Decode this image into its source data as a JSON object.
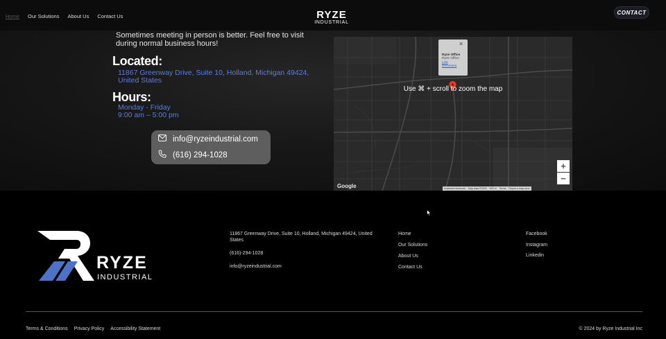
{
  "nav": {
    "home": "Home",
    "solutions": "Our Solutions",
    "about": "About Us",
    "contact": "Contact Us"
  },
  "brand": {
    "word": "RYZE",
    "sub": "INDUSTRIAL"
  },
  "cta": {
    "contact": "CONTACT"
  },
  "contact_section": {
    "intro": "Sometimes meeting in person is better. Feel free to visit during normal business hours!",
    "located_label": "Located:",
    "address": "11867 Greenway Drive, Suite 10, Holland, Michigan 49424, United States",
    "hours_label": "Hours:",
    "days": "Monday - Friday",
    "time": "9:00 am – 5:00 pm",
    "email": "info@ryzeindustrial.com",
    "phone": "(616) 294-1028"
  },
  "map": {
    "hint": "Use ⌘ + scroll to zoom the map",
    "info_title": "Ryze Office",
    "info_sub": "Ryze Office",
    "info_link": "Link",
    "info_directions": "Directions",
    "close": "✕",
    "zoom_in": "+",
    "zoom_out": "−",
    "google": "Google",
    "footer": [
      "Keyboard shortcuts",
      "Map data ©2024",
      "500 m",
      "Terms",
      "Report a map error"
    ]
  },
  "footer": {
    "address": "11867 Greenway Drive, Suite 10, Holland, Michigan 49424, United States",
    "phone": "(616)-294-1028",
    "email": "info@ryzeindustrial.com",
    "links": [
      "Home",
      "Our Solutions",
      "About Us",
      "Contact Us"
    ],
    "social": [
      "Facebook",
      "Instagram",
      "Linkedin"
    ],
    "legal": [
      "Terms & Conditions",
      "Privacy Policy",
      "Accessibility Statement"
    ],
    "copyright": "© 2024 by Ryze Industrial Inc"
  },
  "colors": {
    "accent_blue": "#5a7ee0",
    "logo_blue": "#4d72c8",
    "marker_red": "#d9412f"
  },
  "icons": [
    "mail-icon",
    "phone-icon",
    "map-marker-icon",
    "close-icon",
    "zoom-in-icon",
    "zoom-out-icon",
    "cursor-icon"
  ]
}
